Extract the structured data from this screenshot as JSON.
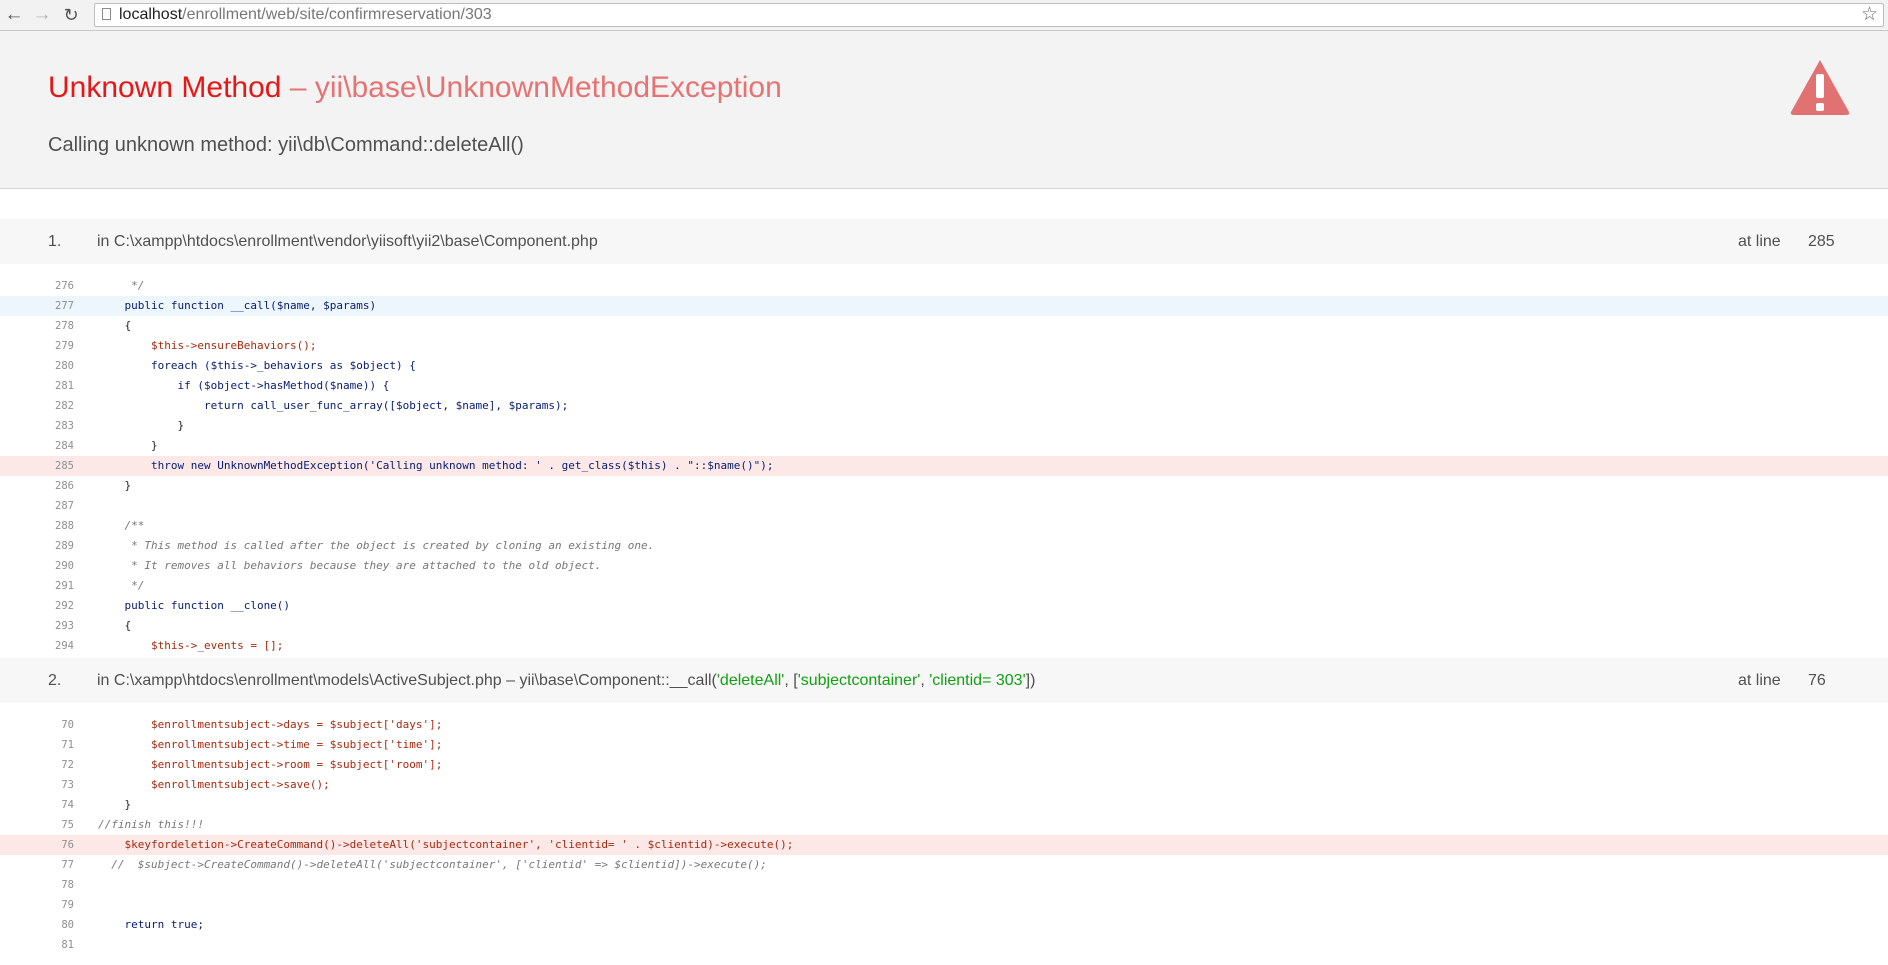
{
  "browser": {
    "url_host": "localhost",
    "url_path": "/enrollment/web/site/confirmreservation/303"
  },
  "error": {
    "name": "Unknown Method",
    "separator": " – ",
    "exception_class": "yii\\base\\UnknownMethodException",
    "message": "Calling unknown method: yii\\db\\Command::deleteAll()"
  },
  "frames": [
    {
      "index": "1.",
      "file_text": "in C:\\xampp\\htdocs\\enrollment\\vendor\\yiisoft\\yii2\\base\\Component.php",
      "at_line_label": "at line",
      "line": "285"
    },
    {
      "index": "2.",
      "file_prefix": "in C:\\xampp\\htdocs\\enrollment\\models\\ActiveSubject.php – yii\\base\\Component::__call(",
      "arg1": "'deleteAll'",
      "mid1": ", [",
      "arg2": "'subjectcontainer'",
      "mid2": ", ",
      "arg3": "'clientid= 303'",
      "suffix": "])",
      "at_line_label": "at line",
      "line": "76"
    }
  ],
  "code1": [
    {
      "n": "276",
      "t": "     */"
    },
    {
      "n": "277",
      "t": "    public function __call($name, $params)"
    },
    {
      "n": "278",
      "t": "    {"
    },
    {
      "n": "279",
      "t": "        $this->ensureBehaviors();"
    },
    {
      "n": "280",
      "t": "        foreach ($this->_behaviors as $object) {"
    },
    {
      "n": "281",
      "t": "            if ($object->hasMethod($name)) {"
    },
    {
      "n": "282",
      "t": "                return call_user_func_array([$object, $name], $params);"
    },
    {
      "n": "283",
      "t": "            }"
    },
    {
      "n": "284",
      "t": "        }"
    },
    {
      "n": "285",
      "t": "        throw new UnknownMethodException('Calling unknown method: ' . get_class($this) . \"::$name()\");"
    },
    {
      "n": "286",
      "t": "    }"
    },
    {
      "n": "287",
      "t": ""
    },
    {
      "n": "288",
      "t": "    /**"
    },
    {
      "n": "289",
      "t": "     * This method is called after the object is created by cloning an existing one."
    },
    {
      "n": "290",
      "t": "     * It removes all behaviors because they are attached to the old object."
    },
    {
      "n": "291",
      "t": "     */"
    },
    {
      "n": "292",
      "t": "    public function __clone()"
    },
    {
      "n": "293",
      "t": "    {"
    },
    {
      "n": "294",
      "t": "        $this->_events = [];"
    }
  ],
  "code2": [
    {
      "n": "70",
      "t": "        $enrollmentsubject->days = $subject['days'];"
    },
    {
      "n": "71",
      "t": "        $enrollmentsubject->time = $subject['time'];"
    },
    {
      "n": "72",
      "t": "        $enrollmentsubject->room = $subject['room'];"
    },
    {
      "n": "73",
      "t": "        $enrollmentsubject->save();"
    },
    {
      "n": "74",
      "t": "    }"
    },
    {
      "n": "75",
      "t": "//finish this!!!"
    },
    {
      "n": "76",
      "t": "    $keyfordeletion->CreateCommand()->deleteAll('subjectcontainer', 'clientid= ' . $clientid)->execute();"
    },
    {
      "n": "77",
      "t": "  //  $subject->CreateCommand()->deleteAll('subjectcontainer', ['clientid' => $clientid])->execute();"
    },
    {
      "n": "78",
      "t": ""
    },
    {
      "n": "79",
      "t": ""
    },
    {
      "n": "80",
      "t": "    return true;"
    },
    {
      "n": "81",
      "t": ""
    }
  ],
  "colors": {
    "error_red": "#e51717",
    "error_light": "#e57373",
    "error_line_bg": "#fde8e8",
    "highlight_line_bg": "#edf6fd",
    "string_green": "#12a012"
  },
  "icons": [
    "back-arrow-icon",
    "forward-arrow-icon",
    "reload-icon",
    "page-icon",
    "star-icon",
    "warning-icon"
  ]
}
